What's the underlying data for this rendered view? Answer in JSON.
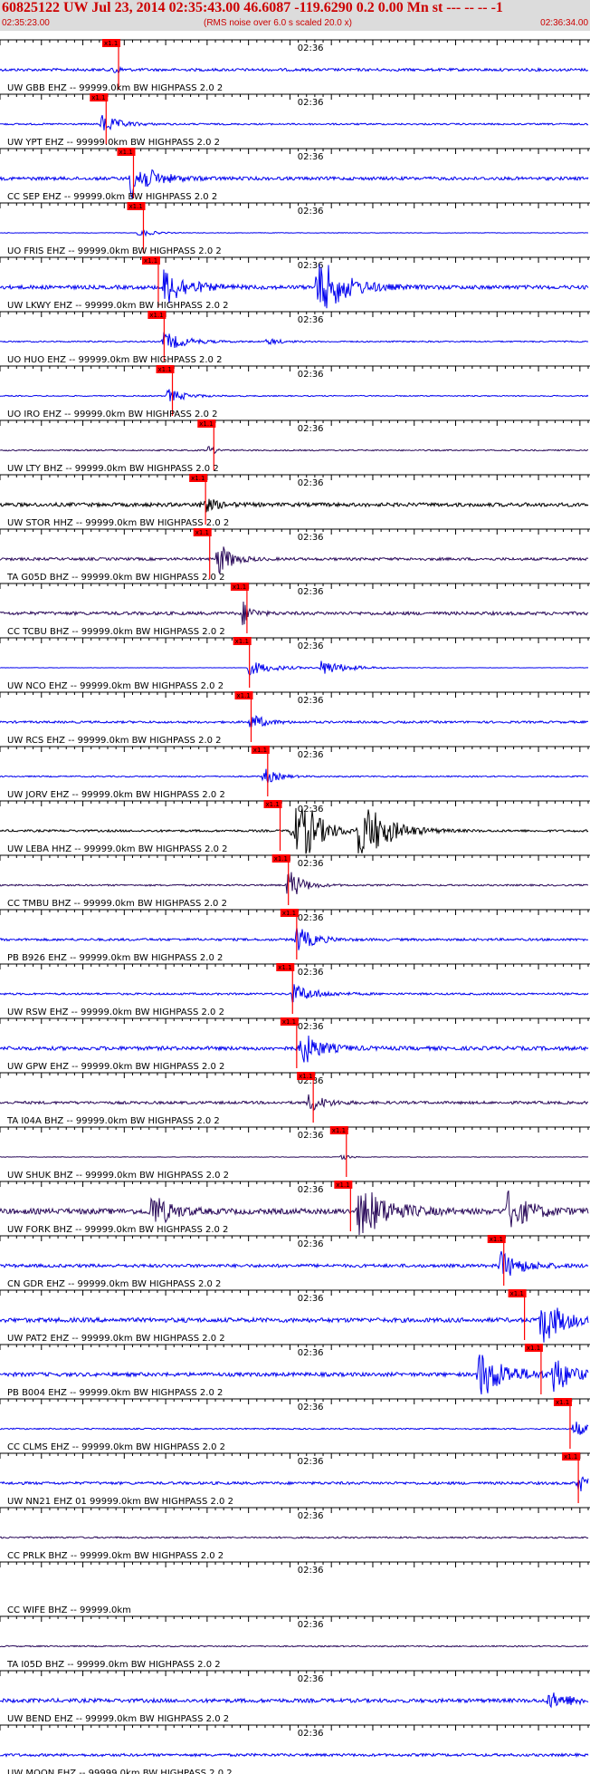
{
  "header": {
    "title": "60825122 UW Jul 23, 2014 02:35:43.00   46.6087 -119.6290  0.2 0.00 Mn st --- -- --   -1",
    "start_time": "02:35:23.00",
    "subtitle": "(RMS noise over 6.0 s scaled 20.0 x)",
    "end_time": "02:36:34.00"
  },
  "chart_data": {
    "type": "seismogram",
    "t_start_s": 0,
    "t_end_s": 71,
    "minute_label": "02:36",
    "minute_label_s": 37,
    "pick_label": "x1.1",
    "colors": {
      "blue": "#0000ee",
      "black": "#000000",
      "purple": "#2a0a5a",
      "pick": "#ff0000",
      "background_header": "#dcdcdc"
    },
    "traces": [
      {
        "label": "UW GBB EHZ -- 99999.0km BW  HIGHPASS  2.0  2",
        "color": "blue",
        "amp": 0.25,
        "pick_s": 13.0,
        "bursts": [
          [
            13.5,
            0.5,
            2.5
          ]
        ]
      },
      {
        "label": "UW YPT EHZ -- 99999.0km BW  HIGHPASS  2.0  2",
        "color": "blue",
        "amp": 0.15,
        "pick_s": 11.5,
        "bursts": [
          [
            12.0,
            2.0,
            2.0
          ]
        ]
      },
      {
        "label": "CC SEP EHZ -- 99999.0km BW  HIGHPASS  2.0  2",
        "color": "blue",
        "amp": 0.3,
        "pick_s": 14.8,
        "bursts": [
          [
            15.5,
            2.5,
            4.0
          ]
        ]
      },
      {
        "label": "UO FRIS EHZ -- 99999.0km BW  HIGHPASS  2.0  2",
        "color": "blue",
        "amp": 0.05,
        "pick_s": 16.0,
        "bursts": [
          [
            16.5,
            1.5,
            1.0
          ]
        ]
      },
      {
        "label": "UW LKWY EHZ -- 99999.0km BW  HIGHPASS  2.0  2",
        "color": "blue",
        "amp": 0.35,
        "pick_s": 17.8,
        "bursts": [
          [
            19.5,
            2.5,
            4.0
          ],
          [
            38.0,
            2.8,
            7.0
          ]
        ]
      },
      {
        "label": "UO HUO EHZ -- 99999.0km BW  HIGHPASS  2.0  2",
        "color": "blue",
        "amp": 0.12,
        "pick_s": 18.5,
        "bursts": [
          [
            19.5,
            2.5,
            2.0
          ],
          [
            32.0,
            1.5,
            0.8
          ]
        ]
      },
      {
        "label": "UO IRO EHZ -- 99999.0km BW  HIGHPASS  2.0  2",
        "color": "blue",
        "amp": 0.1,
        "pick_s": 19.5,
        "bursts": [
          [
            20.0,
            2.0,
            1.5
          ]
        ]
      },
      {
        "label": "UW LTY BHZ -- 99999.0km BW  HIGHPASS  2.0  2",
        "color": "purple",
        "amp": 0.12,
        "pick_s": 24.5,
        "bursts": [
          [
            25.0,
            0.6,
            2.0
          ]
        ]
      },
      {
        "label": "UW STOR HHZ -- 99999.0km BW  HIGHPASS  2.0  2",
        "color": "black",
        "amp": 0.35,
        "pick_s": 23.5,
        "bursts": [
          [
            24.0,
            1.5,
            2.0
          ]
        ]
      },
      {
        "label": "TA G05D BHZ -- 99999.0km BW  HIGHPASS  2.0  2",
        "color": "purple",
        "amp": 0.25,
        "pick_s": 24.0,
        "bursts": [
          [
            26.0,
            1.5,
            4.0
          ]
        ]
      },
      {
        "label": "CC TCBU BHZ -- 99999.0km BW  HIGHPASS  2.0  2",
        "color": "purple",
        "amp": 0.3,
        "pick_s": 28.5,
        "bursts": [
          [
            29.0,
            1.0,
            3.0
          ]
        ]
      },
      {
        "label": "UW NCO EHZ -- 99999.0km BW  HIGHPASS  2.0  2",
        "color": "blue",
        "amp": 0.03,
        "pick_s": 28.8,
        "bursts": [
          [
            29.8,
            3.0,
            1.5
          ],
          [
            38.5,
            3.0,
            1.5
          ]
        ]
      },
      {
        "label": "UW RCS EHZ -- 99999.0km BW  HIGHPASS  2.0  2",
        "color": "blue",
        "amp": 0.2,
        "pick_s": 29.0,
        "bursts": [
          [
            30.0,
            1.5,
            2.0
          ]
        ]
      },
      {
        "label": "UW JORV EHZ -- 99999.0km BW  HIGHPASS  2.0  2",
        "color": "blue",
        "amp": 0.12,
        "pick_s": 31.0,
        "bursts": [
          [
            31.5,
            1.5,
            2.0
          ]
        ]
      },
      {
        "label": "UW LEBA HHZ -- 99999.0km BW  HIGHPASS  2.0  2",
        "color": "black",
        "amp": 0.2,
        "pick_s": 32.5,
        "bursts": [
          [
            35.0,
            2.0,
            14.0
          ],
          [
            43.0,
            2.8,
            8.0
          ]
        ]
      },
      {
        "label": "CC TMBU BHZ -- 99999.0km BW  HIGHPASS  2.0  2",
        "color": "purple",
        "amp": 0.15,
        "pick_s": 33.5,
        "bursts": [
          [
            34.5,
            1.5,
            4.0
          ]
        ]
      },
      {
        "label": "PB B926 EHZ -- 99999.0km BW  HIGHPASS  2.0  2",
        "color": "blue",
        "amp": 0.22,
        "pick_s": 34.5,
        "bursts": [
          [
            35.5,
            1.8,
            3.0
          ]
        ]
      },
      {
        "label": "UW RSW EHZ -- 99999.0km BW  HIGHPASS  2.0  2",
        "color": "blue",
        "amp": 0.18,
        "pick_s": 34.0,
        "bursts": [
          [
            35.0,
            2.5,
            2.0
          ]
        ]
      },
      {
        "label": "UW GPW EHZ -- 99999.0km BW  HIGHPASS  2.0  2",
        "color": "blue",
        "amp": 0.35,
        "pick_s": 34.5,
        "bursts": [
          [
            36.0,
            2.0,
            4.0
          ]
        ]
      },
      {
        "label": "TA I04A BHZ -- 99999.0km BW  HIGHPASS  2.0  2",
        "color": "purple",
        "amp": 0.25,
        "pick_s": 36.5,
        "bursts": [
          [
            37.0,
            1.8,
            2.0
          ]
        ]
      },
      {
        "label": "UW SHUK BHZ -- 99999.0km BW  HIGHPASS  2.0  2",
        "color": "purple",
        "amp": 0.05,
        "pick_s": 40.5,
        "bursts": [
          [
            41.0,
            0.8,
            1.0
          ]
        ]
      },
      {
        "label": "UW FORK BHZ -- 99999.0km BW  HIGHPASS  2.0  2",
        "color": "purple",
        "amp": 0.5,
        "pick_s": 41.0,
        "bursts": [
          [
            43.0,
            3.0,
            6.0
          ],
          [
            18.0,
            2.0,
            4.0
          ],
          [
            61.0,
            2.5,
            4.0
          ]
        ]
      },
      {
        "label": "CN GDR EHZ -- 99999.0km BW  HIGHPASS  2.0  2",
        "color": "blue",
        "amp": 0.3,
        "pick_s": 59.5,
        "bursts": [
          [
            60.0,
            2.5,
            3.0
          ]
        ]
      },
      {
        "label": "UW PAT2 EHZ -- 99999.0km BW  HIGHPASS  2.0  2",
        "color": "blue",
        "amp": 0.4,
        "pick_s": 62.0,
        "bursts": [
          [
            65.0,
            2.5,
            5.0
          ]
        ]
      },
      {
        "label": "PB B004 EHZ -- 99999.0km BW  HIGHPASS  2.0  2",
        "color": "blue",
        "amp": 0.35,
        "pick_s": 64.0,
        "bursts": [
          [
            57.5,
            3.0,
            5.0
          ],
          [
            66.5,
            2.0,
            4.0
          ]
        ]
      },
      {
        "label": "CC CLMS EHZ -- 99999.0km BW  HIGHPASS  2.0  2",
        "color": "blue",
        "amp": 0.12,
        "pick_s": 67.5,
        "bursts": [
          [
            69.0,
            1.5,
            2.0
          ]
        ]
      },
      {
        "label": "UW NN21 EHZ 01 99999.0km BW  HIGHPASS  2.0  2",
        "color": "blue",
        "amp": 0.25,
        "pick_s": 68.5,
        "bursts": [
          [
            69.5,
            1.5,
            2.0
          ]
        ]
      },
      {
        "label": "CC PRLK BHZ -- 99999.0km BW  HIGHPASS  2.0  2",
        "color": "purple",
        "amp": 0.15,
        "pick_s": null,
        "bursts": []
      },
      {
        "label": "CC WIFE BHZ -- 99999.0km",
        "color": "purple",
        "amp": 0.0,
        "pick_s": null,
        "bursts": []
      },
      {
        "label": "TA I05D BHZ -- 99999.0km BW  HIGHPASS  2.0  2",
        "color": "purple",
        "amp": 0.12,
        "pick_s": null,
        "bursts": []
      },
      {
        "label": "UW BEND EHZ -- 99999.0km BW  HIGHPASS  2.0  2",
        "color": "blue",
        "amp": 0.35,
        "pick_s": null,
        "bursts": [
          [
            66.0,
            3.0,
            1.5
          ]
        ]
      },
      {
        "label": "UW MOON EHZ -- 99999.0km BW  HIGHPASS  2.0  2",
        "color": "blue",
        "amp": 0.25,
        "pick_s": null,
        "bursts": []
      }
    ]
  }
}
